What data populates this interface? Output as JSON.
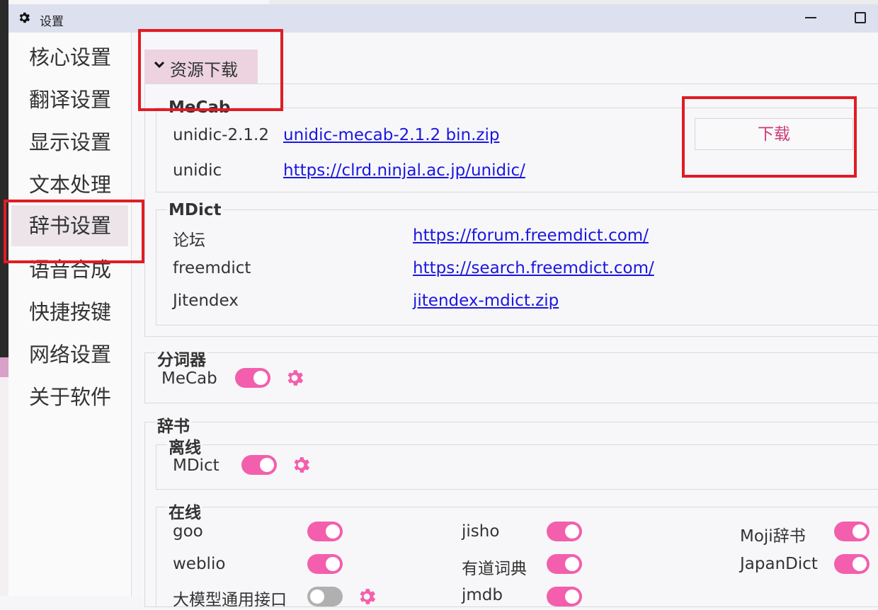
{
  "window": {
    "title": "设置"
  },
  "sidebar": {
    "items": [
      {
        "label": "核心设置"
      },
      {
        "label": "翻译设置"
      },
      {
        "label": "显示设置"
      },
      {
        "label": "文本处理"
      },
      {
        "label": "辞书设置"
      },
      {
        "label": "语音合成"
      },
      {
        "label": "快捷按键"
      },
      {
        "label": "网络设置"
      },
      {
        "label": "关于软件"
      }
    ],
    "active": "辞书设置"
  },
  "resources": {
    "header": "资源下载",
    "mecab": {
      "title": "MeCab",
      "rows": [
        {
          "name": "unidic-2.1.2",
          "link": "unidic-mecab-2.1.2 bin.zip"
        },
        {
          "name": "unidic",
          "link": "https://clrd.ninjal.ac.jp/unidic/"
        }
      ],
      "download_label": "下载"
    },
    "mdict": {
      "title": "MDict",
      "rows": [
        {
          "name": "论坛",
          "link": "https://forum.freemdict.com/"
        },
        {
          "name": "freemdict",
          "link": "https://search.freemdict.com/"
        },
        {
          "name": "Jitendex",
          "link": "jitendex-mdict.zip"
        }
      ]
    }
  },
  "tokenizer": {
    "title": "分词器",
    "mecab_label": "MeCab",
    "mecab_enabled": true
  },
  "dict": {
    "title": "辞书",
    "offline": {
      "title": "离线",
      "mdict_label": "MDict",
      "mdict_enabled": true
    },
    "online": {
      "title": "在线",
      "items": [
        {
          "label": "goo",
          "enabled": true
        },
        {
          "label": "jisho",
          "enabled": true
        },
        {
          "label": "Moji辞书",
          "enabled": true
        },
        {
          "label": "weblio",
          "enabled": true
        },
        {
          "label": "有道词典",
          "enabled": true
        },
        {
          "label": "JapanDict",
          "enabled": true
        },
        {
          "label": "大模型通用接口",
          "enabled": false
        },
        {
          "label": "jmdb",
          "enabled": true
        }
      ]
    }
  },
  "colors": {
    "accent": "#f35fac",
    "link": "#1a16e0",
    "annotation": "#e01c24",
    "header_bg": "#ecd3df"
  }
}
